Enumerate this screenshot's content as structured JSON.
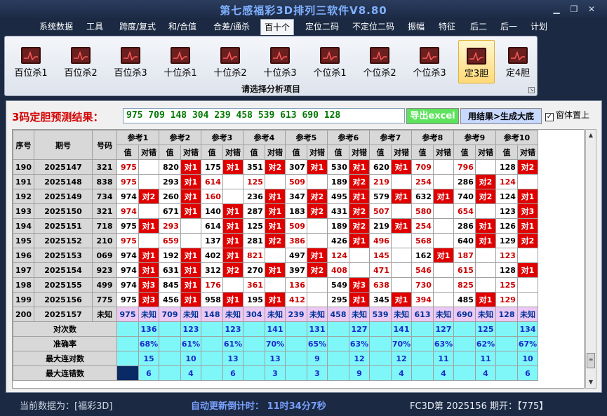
{
  "app": {
    "title": "第七感福彩3D排列三软件V8.80",
    "window_controls": [
      "minimize-icon",
      "restore-icon",
      "close-icon"
    ]
  },
  "menu": [
    "系统数据",
    "工具",
    "跨度/复式",
    "和/合值",
    "合差/通杀",
    "百十个",
    "定位二码",
    "不定位二码",
    "振幅",
    "特征",
    "后二",
    "后一",
    "计划"
  ],
  "menu_active_index": 5,
  "ribbon": {
    "items": [
      "百位杀1",
      "百位杀2",
      "百位杀3",
      "十位杀1",
      "十位杀2",
      "十位杀3",
      "个位杀1",
      "个位杀2",
      "个位杀3",
      "定3胆",
      "定4胆"
    ],
    "active_index": 9,
    "caption": "请选择分析项目"
  },
  "prediction": {
    "label": "3码定胆预测结果：",
    "value": "975 709 148 304 239 458 539 613 690 128",
    "export_button": "导出excel",
    "use_button": "用结果>生成大底",
    "topmost_label": "窗体置上",
    "topmost_checked": true
  },
  "table": {
    "col_headers": [
      "序号",
      "期号",
      "号码"
    ],
    "ref_headers": [
      "参考1",
      "参考2",
      "参考3",
      "参考4",
      "参考5",
      "参考6",
      "参考7",
      "参考8",
      "参考9",
      "参考10"
    ],
    "sub_headers": [
      "值",
      "对错"
    ],
    "rows": [
      {
        "seq": "190",
        "issue": "2025147",
        "num": "321",
        "refs": [
          [
            "975",
            ""
          ],
          [
            "820",
            "对1"
          ],
          [
            "175",
            "对1"
          ],
          [
            "351",
            "对2"
          ],
          [
            "307",
            "对1"
          ],
          [
            "530",
            "对1"
          ],
          [
            "620",
            "对1"
          ],
          [
            "709",
            ""
          ],
          [
            "796",
            ""
          ],
          [
            "128",
            "对2"
          ]
        ]
      },
      {
        "seq": "191",
        "issue": "2025148",
        "num": "838",
        "refs": [
          [
            "975",
            ""
          ],
          [
            "293",
            "对1"
          ],
          [
            "614",
            ""
          ],
          [
            "125",
            ""
          ],
          [
            "509",
            ""
          ],
          [
            "189",
            "对2"
          ],
          [
            "219",
            ""
          ],
          [
            "254",
            ""
          ],
          [
            "286",
            "对2"
          ],
          [
            "124",
            ""
          ]
        ]
      },
      {
        "seq": "192",
        "issue": "2025149",
        "num": "734",
        "refs": [
          [
            "974",
            "对2"
          ],
          [
            "260",
            "对1"
          ],
          [
            "160",
            ""
          ],
          [
            "236",
            "对1"
          ],
          [
            "347",
            "对2"
          ],
          [
            "495",
            "对1"
          ],
          [
            "579",
            "对1"
          ],
          [
            "632",
            "对1"
          ],
          [
            "740",
            "对2"
          ],
          [
            "124",
            "对1"
          ]
        ]
      },
      {
        "seq": "193",
        "issue": "2025150",
        "num": "321",
        "refs": [
          [
            "974",
            ""
          ],
          [
            "671",
            "对1"
          ],
          [
            "140",
            "对1"
          ],
          [
            "287",
            "对1"
          ],
          [
            "183",
            "对2"
          ],
          [
            "431",
            "对2"
          ],
          [
            "507",
            ""
          ],
          [
            "580",
            ""
          ],
          [
            "654",
            ""
          ],
          [
            "123",
            "对3"
          ]
        ]
      },
      {
        "seq": "194",
        "issue": "2025151",
        "num": "718",
        "refs": [
          [
            "975",
            "对1"
          ],
          [
            "293",
            ""
          ],
          [
            "614",
            "对1"
          ],
          [
            "125",
            "对1"
          ],
          [
            "509",
            ""
          ],
          [
            "189",
            "对2"
          ],
          [
            "219",
            "对1"
          ],
          [
            "254",
            ""
          ],
          [
            "286",
            "对1"
          ],
          [
            "126",
            "对1"
          ]
        ]
      },
      {
        "seq": "195",
        "issue": "2025152",
        "num": "210",
        "refs": [
          [
            "975",
            ""
          ],
          [
            "659",
            ""
          ],
          [
            "137",
            "对1"
          ],
          [
            "281",
            "对2"
          ],
          [
            "386",
            ""
          ],
          [
            "426",
            "对1"
          ],
          [
            "496",
            ""
          ],
          [
            "568",
            ""
          ],
          [
            "640",
            "对1"
          ],
          [
            "129",
            "对2"
          ]
        ]
      },
      {
        "seq": "196",
        "issue": "2025153",
        "num": "069",
        "refs": [
          [
            "974",
            "对1"
          ],
          [
            "192",
            "对1"
          ],
          [
            "402",
            "对1"
          ],
          [
            "821",
            ""
          ],
          [
            "497",
            "对1"
          ],
          [
            "124",
            ""
          ],
          [
            "145",
            ""
          ],
          [
            "162",
            "对1"
          ],
          [
            "187",
            ""
          ],
          [
            "123",
            ""
          ]
        ]
      },
      {
        "seq": "197",
        "issue": "2025154",
        "num": "923",
        "refs": [
          [
            "974",
            "对1"
          ],
          [
            "631",
            "对1"
          ],
          [
            "312",
            "对2"
          ],
          [
            "270",
            "对1"
          ],
          [
            "397",
            "对2"
          ],
          [
            "408",
            ""
          ],
          [
            "471",
            ""
          ],
          [
            "546",
            ""
          ],
          [
            "615",
            ""
          ],
          [
            "128",
            "对1"
          ]
        ]
      },
      {
        "seq": "198",
        "issue": "2025155",
        "num": "499",
        "refs": [
          [
            "974",
            "对3"
          ],
          [
            "845",
            "对1"
          ],
          [
            "176",
            ""
          ],
          [
            "361",
            ""
          ],
          [
            "136",
            ""
          ],
          [
            "549",
            "对3"
          ],
          [
            "638",
            ""
          ],
          [
            "730",
            ""
          ],
          [
            "825",
            ""
          ],
          [
            "125",
            ""
          ]
        ]
      },
      {
        "seq": "199",
        "issue": "2025156",
        "num": "775",
        "refs": [
          [
            "975",
            "对3"
          ],
          [
            "456",
            "对1"
          ],
          [
            "958",
            "对1"
          ],
          [
            "195",
            "对1"
          ],
          [
            "412",
            ""
          ],
          [
            "295",
            "对1"
          ],
          [
            "345",
            "对1"
          ],
          [
            "394",
            ""
          ],
          [
            "485",
            "对1"
          ],
          [
            "129",
            ""
          ]
        ]
      },
      {
        "seq": "200",
        "issue": "2025157",
        "num": "未知",
        "refs": [
          [
            "975",
            "未知"
          ],
          [
            "709",
            "未知"
          ],
          [
            "148",
            "未知"
          ],
          [
            "304",
            "未知"
          ],
          [
            "239",
            "未知"
          ],
          [
            "458",
            "未知"
          ],
          [
            "539",
            "未知"
          ],
          [
            "613",
            "未知"
          ],
          [
            "690",
            "未知"
          ],
          [
            "128",
            "未知"
          ]
        ]
      }
    ],
    "stats": [
      {
        "label": "对次数",
        "values": [
          "136",
          "123",
          "123",
          "141",
          "131",
          "127",
          "141",
          "127",
          "125",
          "134"
        ]
      },
      {
        "label": "准确率",
        "values": [
          "68%",
          "61%",
          "61%",
          "70%",
          "65%",
          "63%",
          "70%",
          "63%",
          "62%",
          "67%"
        ]
      },
      {
        "label": "最大连对数",
        "values": [
          "15",
          "10",
          "13",
          "13",
          "9",
          "12",
          "12",
          "11",
          "11",
          "10"
        ]
      },
      {
        "label": "最大连错数",
        "values": [
          "6",
          "4",
          "6",
          "3",
          "3",
          "9",
          "4",
          "4",
          "4",
          "6"
        ]
      }
    ]
  },
  "status": {
    "current": "当前数据为：[福彩3D]",
    "countdown": "自动更新倒计时：  11时34分7秒",
    "draw": "FC3D第 2025156 期开：【775】"
  },
  "colors": {
    "accent": "#d40000",
    "title": "#7fb0ff",
    "miss": "#e00000",
    "stats": "#7ff6f8",
    "unknown": "#ecc8f4",
    "export_button": "#5de35d",
    "use_button": "#c8d8ff"
  }
}
